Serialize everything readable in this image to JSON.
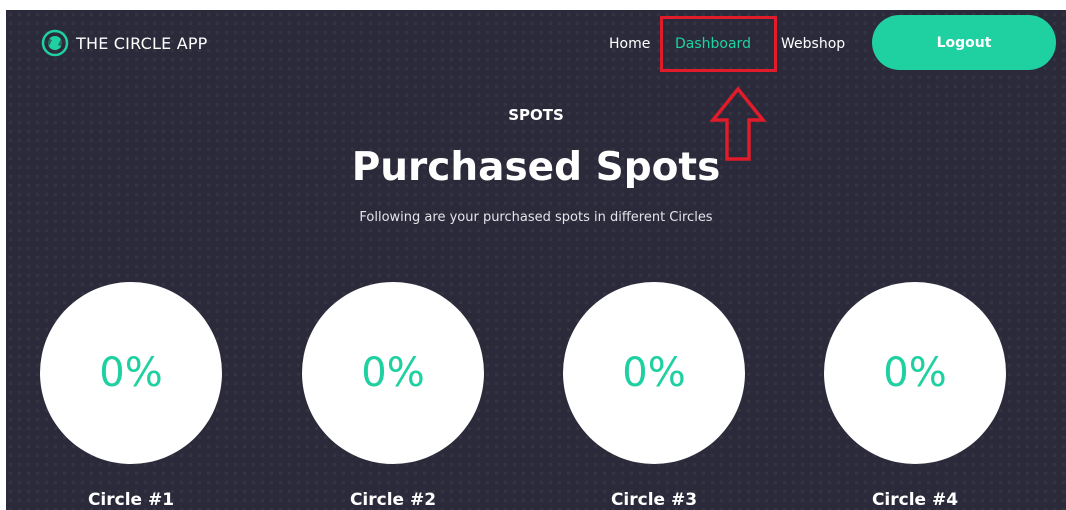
{
  "header": {
    "logo_text": "THE CIRCLE APP",
    "nav": {
      "home": "Home",
      "dashboard": "Dashboard",
      "webshop": "Webshop"
    },
    "logout_label": "Logout",
    "active_nav": "Dashboard"
  },
  "hero": {
    "eyebrow": "SPOTS",
    "title": "Purchased Spots",
    "subtitle": "Following are your purchased spots in different Circles"
  },
  "circles": [
    {
      "percent": "0%",
      "label": "Circle #1"
    },
    {
      "percent": "0%",
      "label": "Circle #2"
    },
    {
      "percent": "0%",
      "label": "Circle #3"
    },
    {
      "percent": "0%",
      "label": "Circle #4"
    }
  ],
  "colors": {
    "background": "#2b2a3a",
    "accent": "#1fd0a1",
    "annotation": "#e01b2a"
  },
  "icons": [
    "circle-app-logo-icon",
    "arrow-up-annotation-icon"
  ]
}
